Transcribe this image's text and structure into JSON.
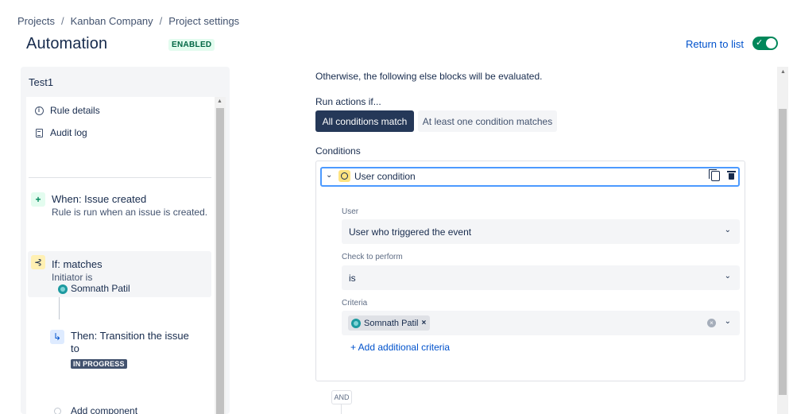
{
  "breadcrumb": [
    "Projects",
    "Kanban Company",
    "Project settings"
  ],
  "breadcrumb_separator": "/",
  "page_title": "Automation",
  "status_badge": "ENABLED",
  "return_link": "Return to list",
  "toggle_on": true,
  "colors": {
    "accent": "#0052cc",
    "toggle": "#00875a",
    "active_segment": "#253858",
    "focus_border": "#4c9aff"
  },
  "sidebar": {
    "rule_name": "Test1",
    "menu": [
      {
        "label": "Rule details",
        "icon": "info-icon"
      },
      {
        "label": "Audit log",
        "icon": "document-icon"
      }
    ],
    "trigger": {
      "title": "When: Issue created",
      "description": "Rule is run when an issue is created.",
      "icon": "plus-icon"
    },
    "condition": {
      "title": "If: matches",
      "description": "Initiator is",
      "user": "Somnath Patil",
      "icon": "branch-icon"
    },
    "action": {
      "title": "Then: Transition the issue to",
      "status": "IN PROGRESS",
      "icon": "transition-icon"
    },
    "add_component": "Add component"
  },
  "main": {
    "else_text": "Otherwise, the following else blocks will be evaluated.",
    "run_actions_label": "Run actions if...",
    "run_options": [
      "All conditions match",
      "At least one condition matches"
    ],
    "run_selected": "All conditions match",
    "conditions_label": "Conditions",
    "condition_card": {
      "title": "User condition",
      "fields": {
        "user": {
          "label": "User",
          "value": "User who triggered the event"
        },
        "check": {
          "label": "Check to perform",
          "value": "is"
        },
        "criteria": {
          "label": "Criteria",
          "tags": [
            "Somnath Patil"
          ]
        }
      },
      "add_criteria": "+ Add additional criteria"
    },
    "and_label": "AND"
  }
}
